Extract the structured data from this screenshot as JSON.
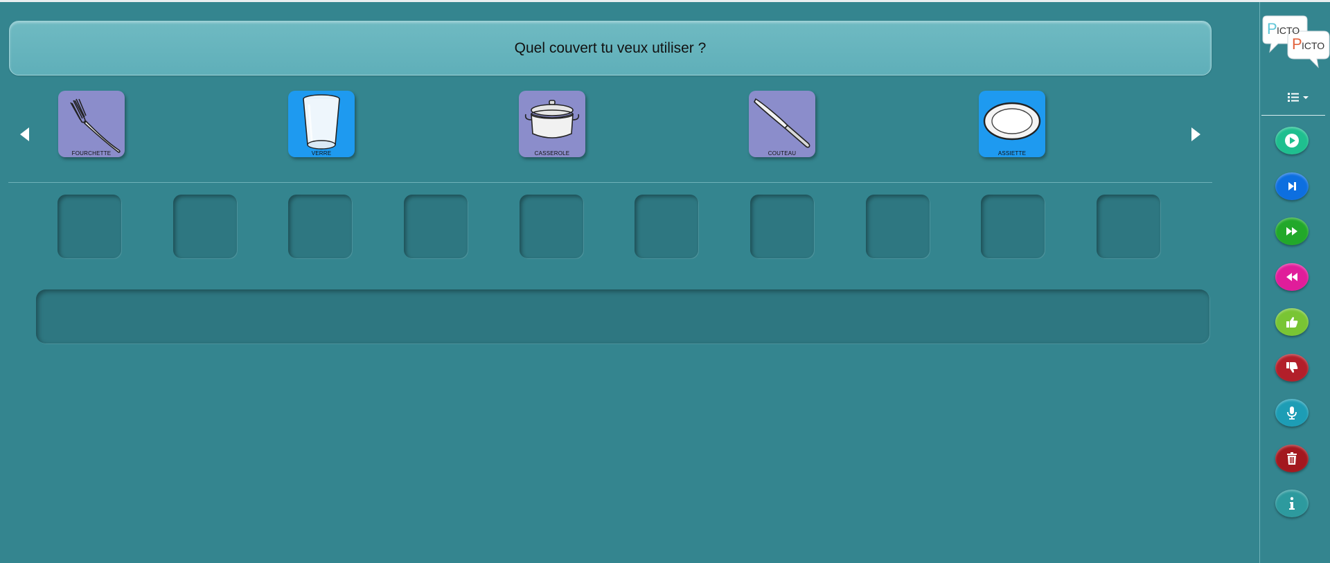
{
  "question": {
    "text": "Quel couvert tu veux utiliser ?"
  },
  "choices": [
    {
      "label": "FOURCHETTE",
      "icon": "fork-icon",
      "color": "#8b8dcb"
    },
    {
      "label": "VERRE",
      "icon": "glass-icon",
      "color": "#1e9af0"
    },
    {
      "label": "CASSEROLE",
      "icon": "saucepan-icon",
      "color": "#8b8dcb"
    },
    {
      "label": "COUTEAU",
      "icon": "knife-icon",
      "color": "#8b8dcb"
    },
    {
      "label": "ASSIETTE",
      "icon": "plate-icon",
      "color": "#1e9af0"
    }
  ],
  "answer_slots_count": 10,
  "logo": {
    "line1": "ICTO",
    "line2": "ICTO",
    "initial1": "P",
    "initial2": "P"
  },
  "controls": [
    {
      "name": "play-button",
      "icon": "play-icon",
      "color": "#1fbf8f"
    },
    {
      "name": "next-button",
      "icon": "skip-next-icon",
      "color": "#0d6fe0"
    },
    {
      "name": "fast-forward-button",
      "icon": "fast-forward-icon",
      "color": "#22a82a"
    },
    {
      "name": "rewind-button",
      "icon": "rewind-icon",
      "color": "#e01d9a"
    },
    {
      "name": "thumbs-up-button",
      "icon": "thumbs-up-icon",
      "color": "#79c534"
    },
    {
      "name": "thumbs-down-button",
      "icon": "thumbs-down-icon",
      "color": "#b21f2a"
    },
    {
      "name": "microphone-button",
      "icon": "microphone-icon",
      "color": "#1d9db5"
    },
    {
      "name": "delete-button",
      "icon": "trash-icon",
      "color": "#a3181f"
    },
    {
      "name": "info-button",
      "icon": "info-icon",
      "color": "#2d9a9e"
    }
  ],
  "colors": {
    "background": "#34858f",
    "question_bar": "#64b3bc",
    "slot": "#2e7781"
  }
}
